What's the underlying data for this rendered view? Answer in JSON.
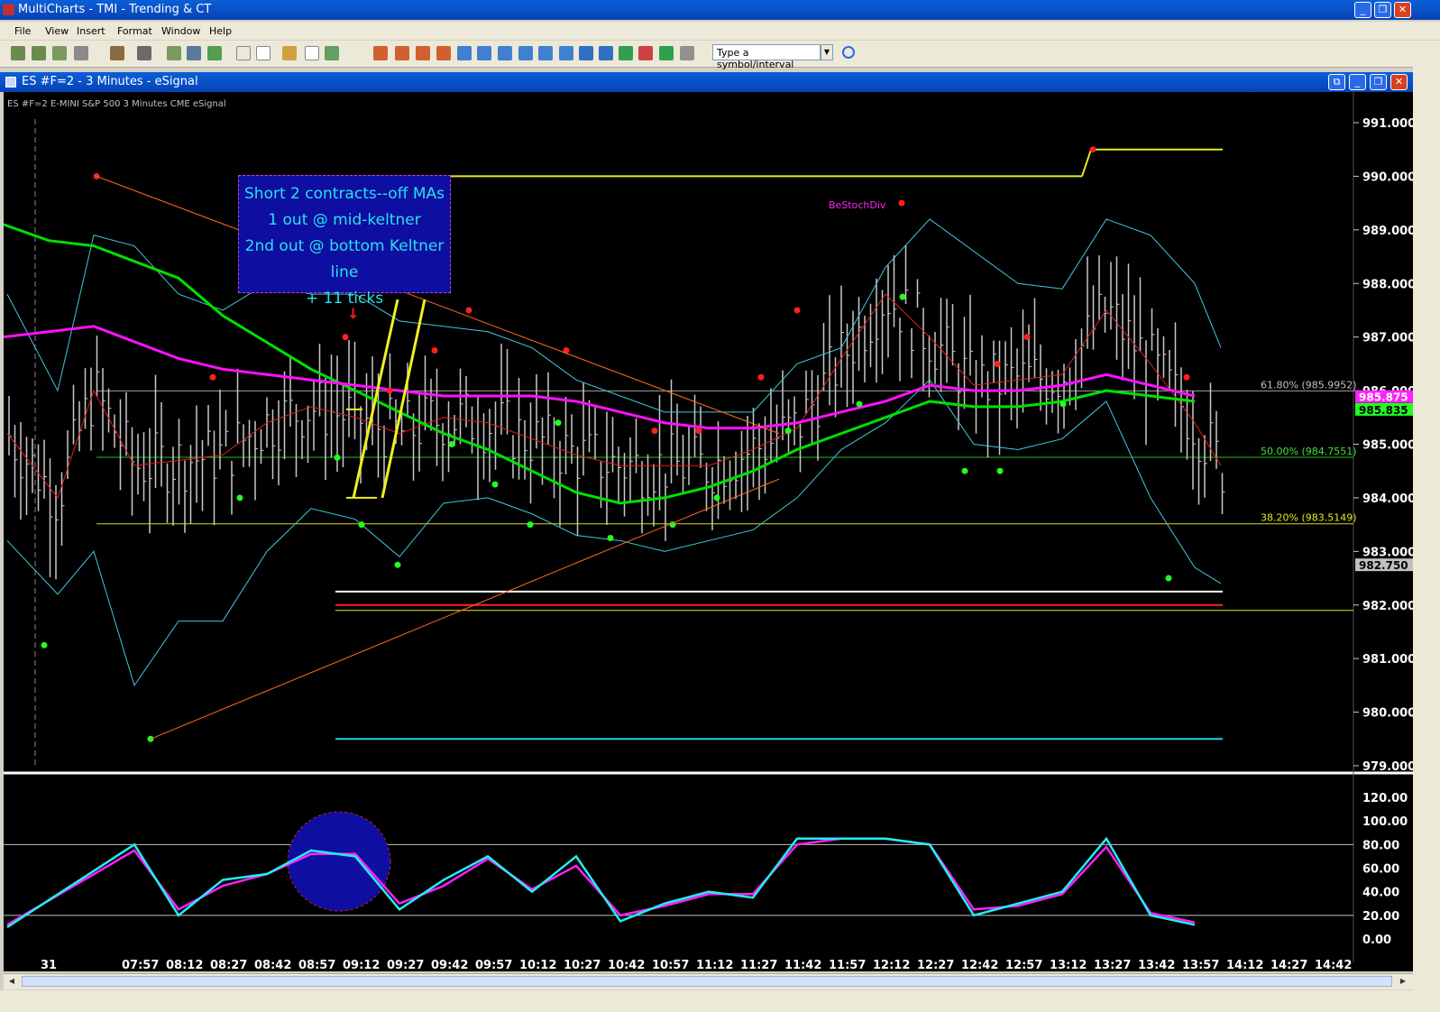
{
  "app": {
    "title": "MultiCharts - TMI - Trending & CT",
    "window_buttons": {
      "minimize": "_",
      "restore": "❐",
      "close": "✕"
    }
  },
  "menu": [
    "File",
    "View",
    "Insert",
    "Format",
    "Window",
    "Help"
  ],
  "toolbar": {
    "symbol_placeholder": "Type a symbol/interval"
  },
  "chart_window": {
    "title": "ES #F=2 - 3 Minutes - eSignal",
    "info": "ES #F=2  E-MINI S&P 500  3 Minutes  CME  eSignal"
  },
  "annotation": {
    "lines": [
      "Short 2 contracts--off MAs",
      "1  out @ mid-keltner",
      "2nd out @ bottom Keltner line",
      "+ 11 ticks"
    ],
    "divergence_label": "BeStochDiv"
  },
  "price_scale": [
    "991.000",
    "990.000",
    "989.000",
    "988.000",
    "987.000",
    "986.000",
    "985.000",
    "984.000",
    "983.000",
    "982.000",
    "981.000",
    "980.000",
    "979.000"
  ],
  "price_markers": {
    "ma_magenta": "985.875",
    "ma_green": "985.835",
    "last_price": "982.750"
  },
  "fib_labels": [
    "61.80% (985.9952)",
    "50.00% (984.7551)",
    "38.20% (983.5149)"
  ],
  "osc_scale": [
    "120.00",
    "100.00",
    "80.00",
    "60.00",
    "40.00",
    "20.00",
    "0.00"
  ],
  "time_labels": [
    "31",
    "07:57",
    "08:12",
    "08:27",
    "08:42",
    "08:57",
    "09:12",
    "09:27",
    "09:42",
    "09:57",
    "10:12",
    "10:27",
    "10:42",
    "10:57",
    "11:12",
    "11:27",
    "11:42",
    "11:57",
    "12:12",
    "12:27",
    "12:42",
    "12:57",
    "13:12",
    "13:27",
    "13:42",
    "13:57",
    "14:12",
    "14:27",
    "14:42"
  ],
  "chart_data": {
    "type": "line",
    "symbol": "ES #F=2",
    "interval": "3 Minutes",
    "ylim": [
      979,
      991
    ],
    "fibonacci": [
      {
        "level": "61.80%",
        "price": 985.9952
      },
      {
        "level": "50.00%",
        "price": 984.7551
      },
      {
        "level": "38.20%",
        "price": 983.5149
      }
    ],
    "series": [
      {
        "x": [
          "07:57",
          "08:12",
          "08:27",
          "08:42",
          "08:57",
          "09:12",
          "09:27",
          "09:42",
          "09:57",
          "10:12",
          "10:27",
          "10:42",
          "10:57",
          "11:12",
          "11:27",
          "11:42",
          "11:57",
          "12:12",
          "12:27",
          "12:42",
          "12:57",
          "13:12",
          "13:27",
          "13:42",
          "13:57"
        ],
        "values": [
          988.6,
          988.1,
          987.4,
          986.9,
          986.4,
          986.0,
          985.6,
          985.2,
          984.9,
          984.5,
          984.1,
          983.9,
          984.0,
          984.2,
          984.5,
          984.9,
          985.2,
          985.5,
          985.8,
          985.7,
          985.7,
          985.8,
          986.0,
          985.9,
          985.8
        ],
        "color": "#00e000"
      },
      {
        "x": [
          "07:57",
          "08:12",
          "08:27",
          "08:42",
          "08:57",
          "09:12",
          "09:27",
          "09:42",
          "09:57",
          "10:12",
          "10:27",
          "10:42",
          "10:57",
          "11:12",
          "11:27",
          "11:42",
          "11:57",
          "12:12",
          "12:27",
          "12:42",
          "12:57",
          "13:12",
          "13:27",
          "13:42",
          "13:57"
        ],
        "values": [
          986.9,
          986.6,
          986.4,
          986.3,
          986.2,
          986.1,
          986.0,
          985.9,
          985.9,
          985.9,
          985.8,
          985.6,
          985.4,
          985.3,
          985.3,
          985.4,
          985.6,
          985.8,
          986.1,
          986.0,
          986.0,
          986.1,
          986.3,
          986.1,
          985.9
        ],
        "color": "#ff10ff"
      }
    ],
    "stochastic": {
      "x": [
        "31",
        "07:57",
        "08:12",
        "08:27",
        "08:42",
        "08:57",
        "09:12",
        "09:27",
        "09:42",
        "09:57",
        "10:12",
        "10:27",
        "10:42",
        "10:57",
        "11:12",
        "11:27",
        "11:42",
        "11:57",
        "12:12",
        "12:27",
        "12:42",
        "12:57",
        "13:12",
        "13:27",
        "13:42",
        "13:57"
      ],
      "k": [
        10,
        80,
        20,
        50,
        55,
        75,
        70,
        25,
        50,
        70,
        40,
        70,
        15,
        30,
        40,
        35,
        85,
        85,
        85,
        80,
        20,
        30,
        40,
        85,
        20,
        12
      ],
      "d": [
        12,
        75,
        25,
        45,
        55,
        72,
        72,
        30,
        45,
        68,
        42,
        62,
        20,
        28,
        38,
        38,
        80,
        85,
        85,
        80,
        25,
        28,
        38,
        78,
        22,
        14
      ],
      "lines": [
        80,
        20
      ]
    }
  }
}
